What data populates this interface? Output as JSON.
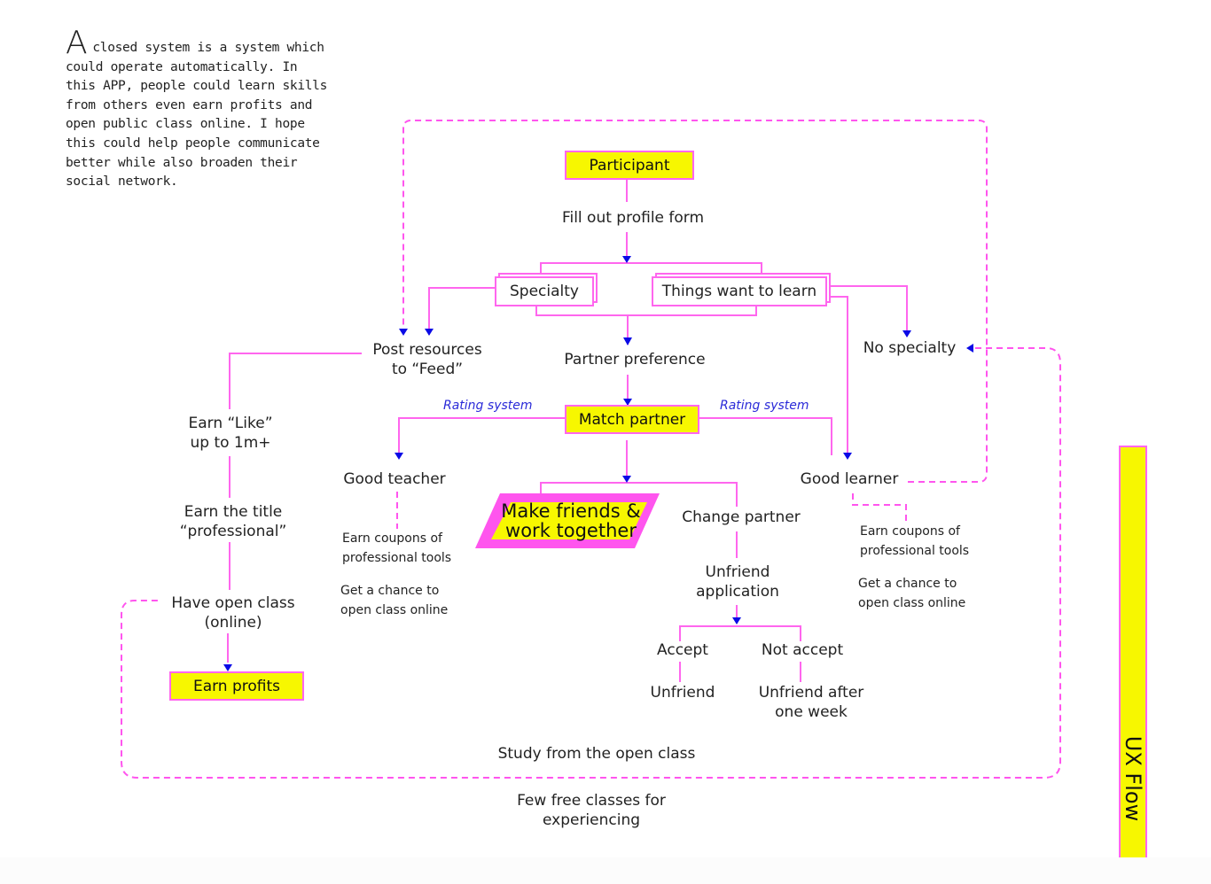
{
  "intro": {
    "dropcap": "A",
    "text": "closed system is a system which could operate automatically. In this APP, people could learn skills from others even earn profits and open public class online. I hope this could help people communicate better while also broaden their social network."
  },
  "colors": {
    "connector": "#ff66ee",
    "arrow": "#0a0ae6",
    "highlight_fill": "#f7f700",
    "rating_text": "#2a2ad8"
  },
  "nodes": {
    "participant": "Participant",
    "fill_profile": "Fill out profile form",
    "specialty": "Specialty",
    "things_to_learn": "Things want to learn",
    "post_resources_1": "Post resources",
    "post_resources_2": "to “Feed”",
    "partner_preference": "Partner preference",
    "no_specialty": "No specialty",
    "match_partner": "Match partner",
    "rating_left": "Rating system",
    "rating_right": "Rating system",
    "good_teacher": "Good teacher",
    "good_learner": "Good learner",
    "make_friends_1": "Make friends &",
    "make_friends_2": "work together",
    "change_partner": "Change partner",
    "unfriend_app_1": "Unfriend",
    "unfriend_app_2": "application",
    "accept": "Accept",
    "not_accept": "Not accept",
    "unfriend": "Unfriend",
    "unfriend_week_1": "Unfriend after",
    "unfriend_week_2": "one week",
    "earn_like_1": "Earn “Like”",
    "earn_like_2": "up to 1m+",
    "earn_title_1": "Earn the title",
    "earn_title_2": "“professional”",
    "open_class_1": "Have open class",
    "open_class_2": "(online)",
    "earn_profits": "Earn profits",
    "teacher_coupons_1": "Earn coupons of",
    "teacher_coupons_2": "professional tools",
    "teacher_chance_1": "Get a chance to",
    "teacher_chance_2": "open class online",
    "learner_coupons_1": "Earn coupons of",
    "learner_coupons_2": "professional tools",
    "learner_chance_1": "Get a chance to",
    "learner_chance_2": "open class online",
    "study_open_class": "Study from the open class",
    "free_classes_1": "Few free classes for",
    "free_classes_2": "experiencing"
  },
  "side_label": "UX Flow"
}
